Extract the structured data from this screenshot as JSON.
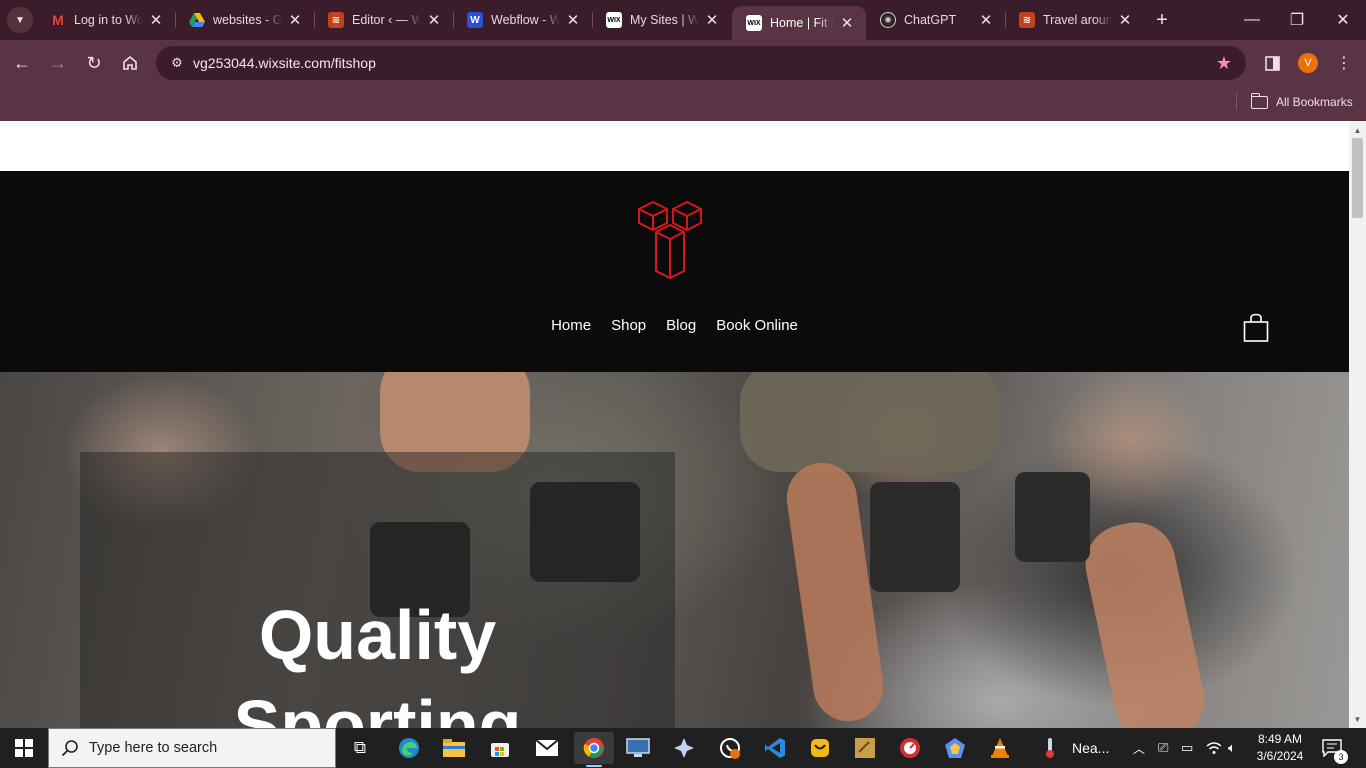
{
  "browser": {
    "tabs": [
      {
        "title": "Log in to WordPress",
        "favicon": "gmail-icon",
        "active": false
      },
      {
        "title": "websites - Google Drive",
        "favicon": "google-drive-icon",
        "active": false
      },
      {
        "title": "Editor ‹ — WordPress",
        "favicon": "site-icon",
        "active": false
      },
      {
        "title": "Webflow - Webflow",
        "favicon": "webflow-icon",
        "active": false
      },
      {
        "title": "My Sites | Wix",
        "favicon": "wix-icon",
        "active": false
      },
      {
        "title": "Home | Fit shop",
        "favicon": "wix-icon",
        "active": true
      },
      {
        "title": "ChatGPT",
        "favicon": "chatgpt-icon",
        "active": false
      },
      {
        "title": "Travel around",
        "favicon": "site-icon",
        "active": false
      }
    ],
    "url": "vg253044.wixsite.com/fitshop",
    "profile_initial": "V",
    "bookmarks_label": "All Bookmarks",
    "accent_color": "#5a3344",
    "tabstrip_color": "#3b1c2a"
  },
  "site": {
    "nav": [
      "Home",
      "Shop",
      "Blog",
      "Book Online"
    ],
    "hero_title_line1": "Quality",
    "hero_title_line2": "Sporting",
    "logo_color": "#d8161d",
    "header_color": "#0b0b0b"
  },
  "taskbar": {
    "search_placeholder": "Type here to search",
    "weather_text": "Nea...",
    "time": "8:49 AM",
    "date": "3/6/2024",
    "notification_count": "3",
    "language": "英"
  }
}
